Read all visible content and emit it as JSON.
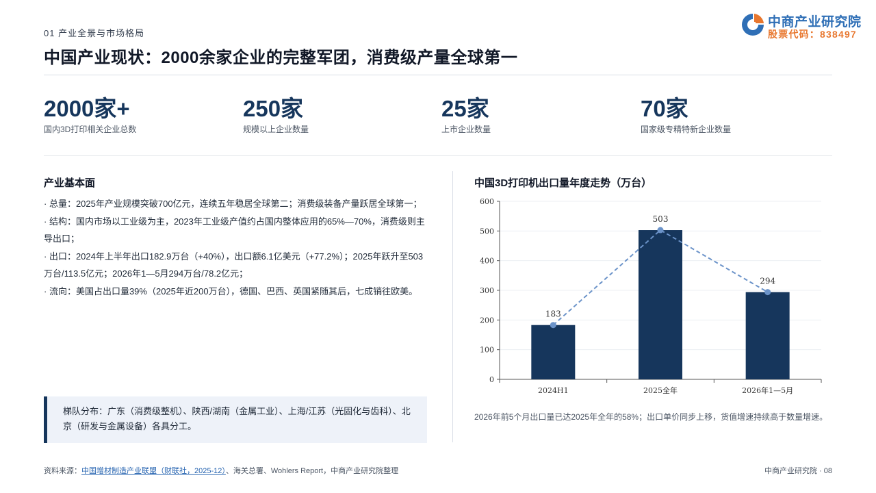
{
  "header": {
    "section": "01 产业全景与市场格局",
    "title": "中国产业现状：2000余家企业的完整军团，消费级产量全球第一"
  },
  "logo": {
    "name": "中商产业研究院",
    "code": "股票代码：838497"
  },
  "stats": [
    {
      "value": "2000家+",
      "label": "国内3D打印相关企业总数"
    },
    {
      "value": "250家",
      "label": "规模以上企业数量"
    },
    {
      "value": "25家",
      "label": "上市企业数量"
    },
    {
      "value": "70家",
      "label": "国家级专精特新企业数量"
    }
  ],
  "fundamentals": {
    "title": "产业基本面",
    "bullets": [
      "· 总量：2025年产业规模突破700亿元，连续五年稳居全球第二；消费级装备产量跃居全球第一；",
      "· 结构：国内市场以工业级为主，2023年工业级产值约占国内整体应用的65%—70%，消费级则主导出口；",
      "· 出口：2024年上半年出口182.9万台（+40%），出口额6.1亿美元（+77.2%）；2025年跃升至503万台/113.5亿元；2026年1—5月294万台/78.2亿元；",
      "· 流向：美国占出口量39%（2025年近200万台），德国、巴西、英国紧随其后，七成销往欧美。"
    ],
    "callout": "梯队分布：广东（消费级整机）、陕西/湖南（金属工业）、上海/江苏（光固化与齿科）、北京（研发与金属设备）各具分工。"
  },
  "chart": {
    "title": "中国3D打印机出口量年度走势（万台）",
    "note": "2026年前5个月出口量已达2025年全年的58%；出口单价同步上移，货值增速持续高于数量增速。"
  },
  "chart_data": {
    "type": "bar",
    "categories": [
      "2024H1",
      "2025全年",
      "2026年1—5月"
    ],
    "values": [
      183,
      503,
      294
    ],
    "data_labels": [
      "183",
      "503",
      "294"
    ],
    "overlay": "dashed line through bar tops",
    "ylim": [
      0,
      600
    ],
    "yticks": [
      "0",
      "100",
      "200",
      "300",
      "400",
      "500",
      "600"
    ],
    "grid": true,
    "colors": {
      "bar": "#16365c",
      "line": "#6b93c9"
    }
  },
  "footer": {
    "source_prefix": "资料来源：",
    "source_link": "中国增材制造产业联盟（财联社，2025-12）",
    "source_rest": "、海关总署、Wohlers Report，中商产业研究院整理",
    "page": "中商产业研究院 · 08"
  }
}
